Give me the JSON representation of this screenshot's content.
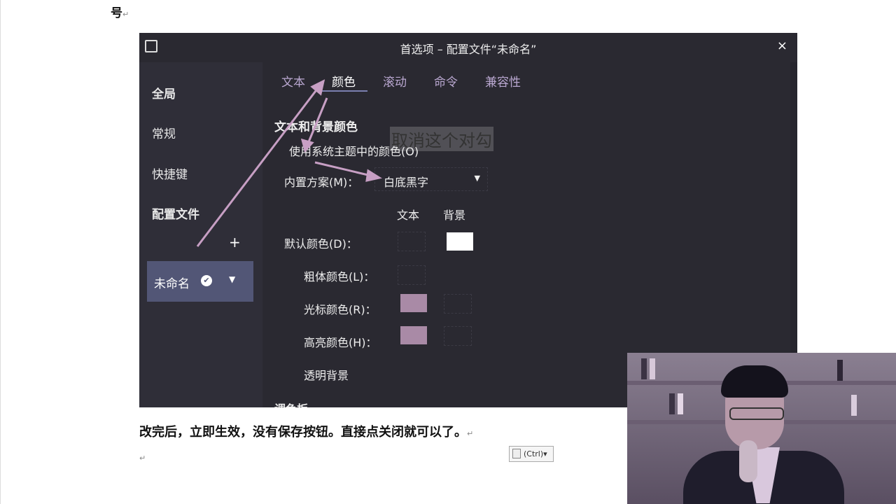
{
  "doc": {
    "top_char": "号",
    "return_mark": "↵",
    "caption": "改完后，立即生效，没有保存按钮。直接点关闭就可以了。",
    "paste_chip": "(Ctrl)▾"
  },
  "dialog": {
    "title": "首选项 – 配置文件“未命名”",
    "close": "×"
  },
  "sidebar": {
    "global": "全局",
    "general": "常规",
    "shortcuts": "快捷键",
    "profiles": "配置文件",
    "add": "+",
    "profile_name": "未命名",
    "check": "✔",
    "dropdown": "▼"
  },
  "tabs": [
    "文本",
    "颜色",
    "滚动",
    "命令",
    "兼容性"
  ],
  "active_tab": "颜色",
  "colors": {
    "section": "文本和背景颜色",
    "annotation": "取消这个对勾",
    "use_system": "使用系统主题中的颜色(O)",
    "scheme_label": "内置方案(M)：",
    "scheme_value": "白底黑字",
    "scheme_arrow": "▼",
    "col_text": "文本",
    "col_bg": "背景",
    "default_color": "默认颜色(D)：",
    "bold_color": "粗体颜色(L)：",
    "cursor_color": "光标颜色(R)：",
    "highlight_color": "高亮颜色(H)：",
    "transparent_bg": "透明背景",
    "palette": "调色板",
    "swatch_white": "#ffffff",
    "swatch_pink": "#a98aa6"
  }
}
